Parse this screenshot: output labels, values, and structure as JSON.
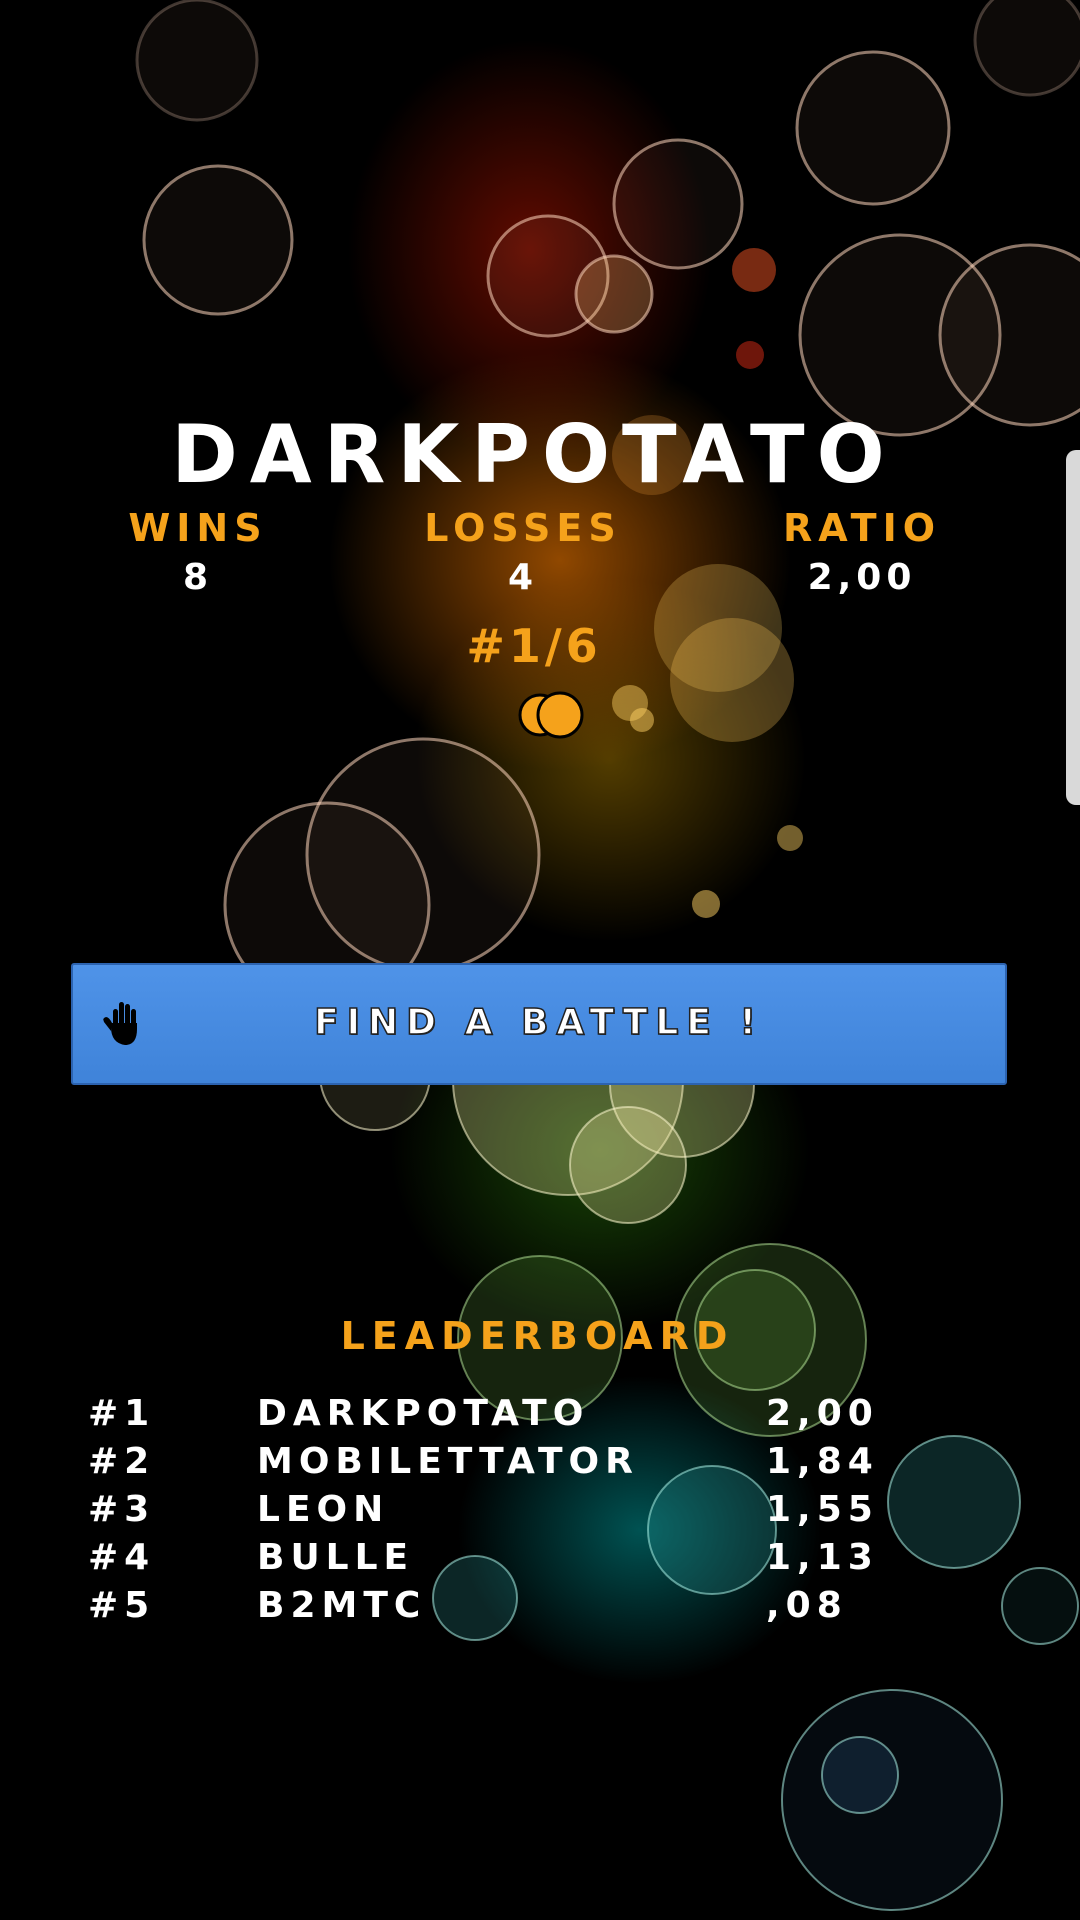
{
  "player": {
    "name": "DARKPOTATO",
    "rank": "#1/6"
  },
  "stats": {
    "wins_label": "WINS",
    "wins_value": "8",
    "losses_label": "LOSSES",
    "losses_value": "4",
    "ratio_label": "RATIO",
    "ratio_value": "2,00"
  },
  "actions": {
    "find_battle_label": "FIND A BATTLE !"
  },
  "leaderboard": {
    "title": "LEADERBOARD",
    "rows": [
      {
        "position": "#1",
        "name": "DARKPOTATO",
        "score": "2,00"
      },
      {
        "position": "#2",
        "name": "MOBILETTATOR",
        "score": "1,84"
      },
      {
        "position": "#3",
        "name": "LEON",
        "score": "1,55"
      },
      {
        "position": "#4",
        "name": "BULLE",
        "score": "1,13"
      },
      {
        "position": "#5",
        "name": "B2MTC",
        "score": ",08"
      }
    ]
  },
  "colors": {
    "accent": "#f5a21b",
    "button": "#4f93e8",
    "text": "#ffffff",
    "background": "#000000"
  },
  "icons": [
    "coins-icon",
    "hand-icon"
  ]
}
